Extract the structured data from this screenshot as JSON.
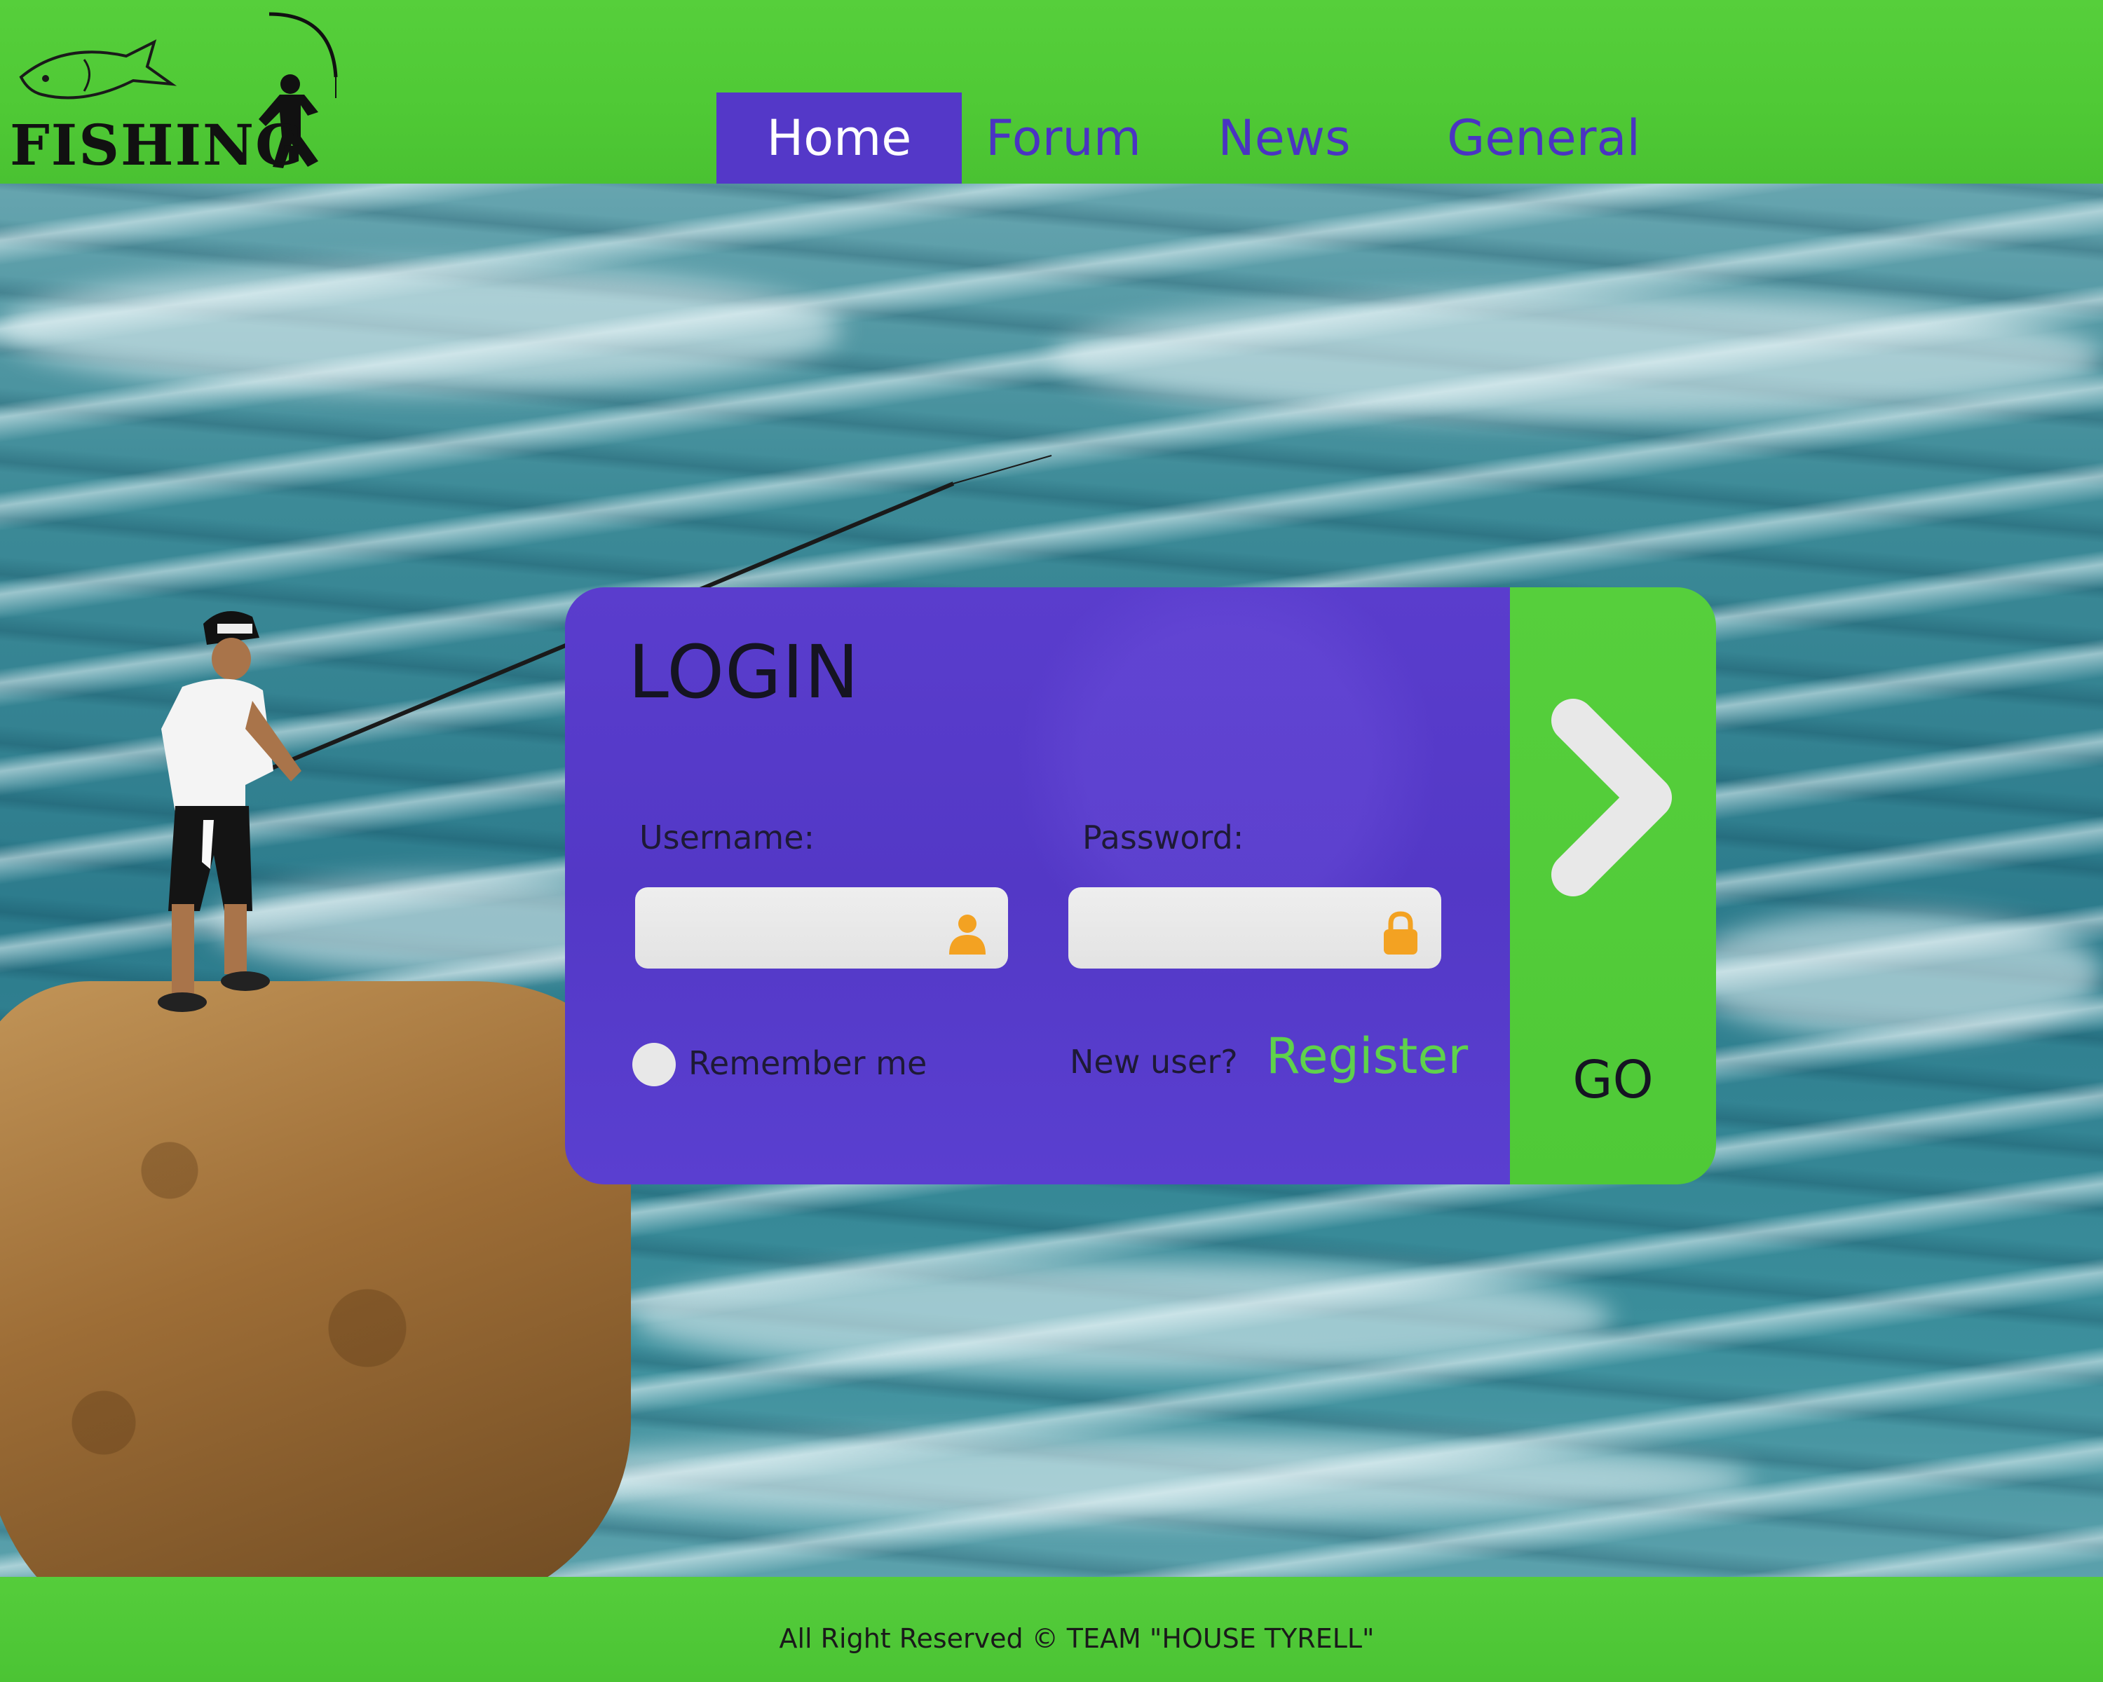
{
  "brand": {
    "logo_text": "FISHING"
  },
  "nav": {
    "items": [
      {
        "label": "Home",
        "active": true
      },
      {
        "label": "Forum",
        "active": false
      },
      {
        "label": "News",
        "active": false
      },
      {
        "label": "General",
        "active": false
      }
    ]
  },
  "login": {
    "title": "LOGIN",
    "username_label": "Username:",
    "password_label": "Password:",
    "username_value": "",
    "password_value": "",
    "username_icon": "user-icon",
    "password_icon": "lock-icon",
    "remember_label": "Remember me",
    "new_user_label": "New user?",
    "register_label": "Register",
    "go_label": "GO",
    "go_icon": "chevron-right-icon"
  },
  "footer": {
    "text": "All Right Reserved © TEAM \"HOUSE TYRELL\""
  },
  "colors": {
    "header_green": "#4fc935",
    "nav_active": "#5438c8",
    "nav_text": "#4a34c2",
    "panel_purple": "#5338c6",
    "register_green": "#5fd24b",
    "icon_orange": "#f3a222",
    "field_gray": "#e6e6e6"
  }
}
